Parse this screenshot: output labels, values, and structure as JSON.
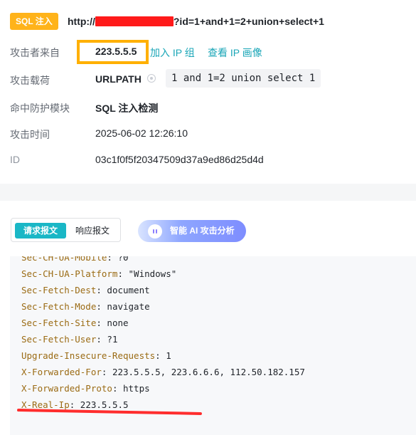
{
  "header": {
    "tag": "SQL 注入",
    "url_prefix": "http://",
    "url_suffix": "?id=1+and+1=2+union+select+1"
  },
  "details": {
    "attacker": {
      "label": "攻击者来自",
      "ip": "223.5.5.5",
      "add_link": "加入 IP 组",
      "profile_link": "查看 IP 画像"
    },
    "payload": {
      "label": "攻击载荷",
      "location": "URLPATH",
      "value": "1 and 1=2 union select 1"
    },
    "module": {
      "label": "命中防护模块",
      "value": "SQL 注入检测"
    },
    "time": {
      "label": "攻击时间",
      "value": "2025-06-02 12:26:10"
    },
    "id": {
      "label": "ID",
      "value": "03c1f0f5f20347509d37a9ed86d25d4d"
    }
  },
  "tabs": {
    "request": "请求报文",
    "response": "响应报文"
  },
  "ai_button": "智能 AI 攻击分析",
  "request_lines": [
    {
      "key": "Sec-CH-UA-Mobile",
      "value": "?0"
    },
    {
      "key": "Sec-CH-UA-Platform",
      "value": "\"Windows\""
    },
    {
      "key": "Sec-Fetch-Dest",
      "value": "document"
    },
    {
      "key": "Sec-Fetch-Mode",
      "value": "navigate"
    },
    {
      "key": "Sec-Fetch-Site",
      "value": "none"
    },
    {
      "key": "Sec-Fetch-User",
      "value": "?1"
    },
    {
      "key": "Upgrade-Insecure-Requests",
      "value": "1"
    },
    {
      "key": "X-Forwarded-For",
      "value": "223.5.5.5, 223.6.6.6, 112.50.182.157"
    },
    {
      "key": "X-Forwarded-Proto",
      "value": "https"
    },
    {
      "key": "X-Real-Ip",
      "value": "223.5.5.5"
    }
  ],
  "colors": {
    "accent": "#1ab7c6",
    "tag": "#ffb31a",
    "highlight_box": "#ffb000",
    "redaction": "#ff1a1a",
    "header_key": "#9b6b14"
  }
}
